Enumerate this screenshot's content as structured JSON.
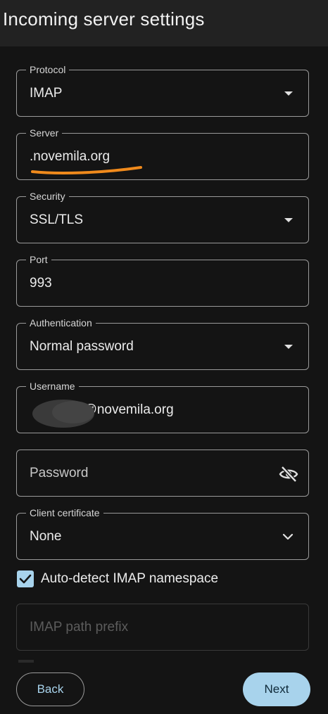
{
  "app_bar": {
    "title": "Incoming server settings"
  },
  "fields": {
    "protocol": {
      "label": "Protocol",
      "value": "IMAP"
    },
    "server": {
      "label": "Server",
      "value": ".novemila.org"
    },
    "security": {
      "label": "Security",
      "value": "SSL/TLS"
    },
    "port": {
      "label": "Port",
      "value": "993"
    },
    "authentication": {
      "label": "Authentication",
      "value": "Normal password"
    },
    "username": {
      "label": "Username",
      "value": "n@novemila.org"
    },
    "password": {
      "placeholder": "Password",
      "toggle_icon": "visibility-off-icon"
    },
    "client_certificate": {
      "label": "Client certificate",
      "value": "None"
    },
    "imap_path_prefix": {
      "placeholder": "IMAP path prefix"
    }
  },
  "auto_detect_namespace": {
    "label": "Auto-detect IMAP namespace",
    "checked": true
  },
  "buttons": {
    "back": "Back",
    "next": "Next"
  },
  "colors": {
    "background": "#141414",
    "app_bar": "#222222",
    "accent": "#a8d3ec",
    "outline": "#9a9a9a",
    "highlight_mark": "#f08a1c"
  }
}
